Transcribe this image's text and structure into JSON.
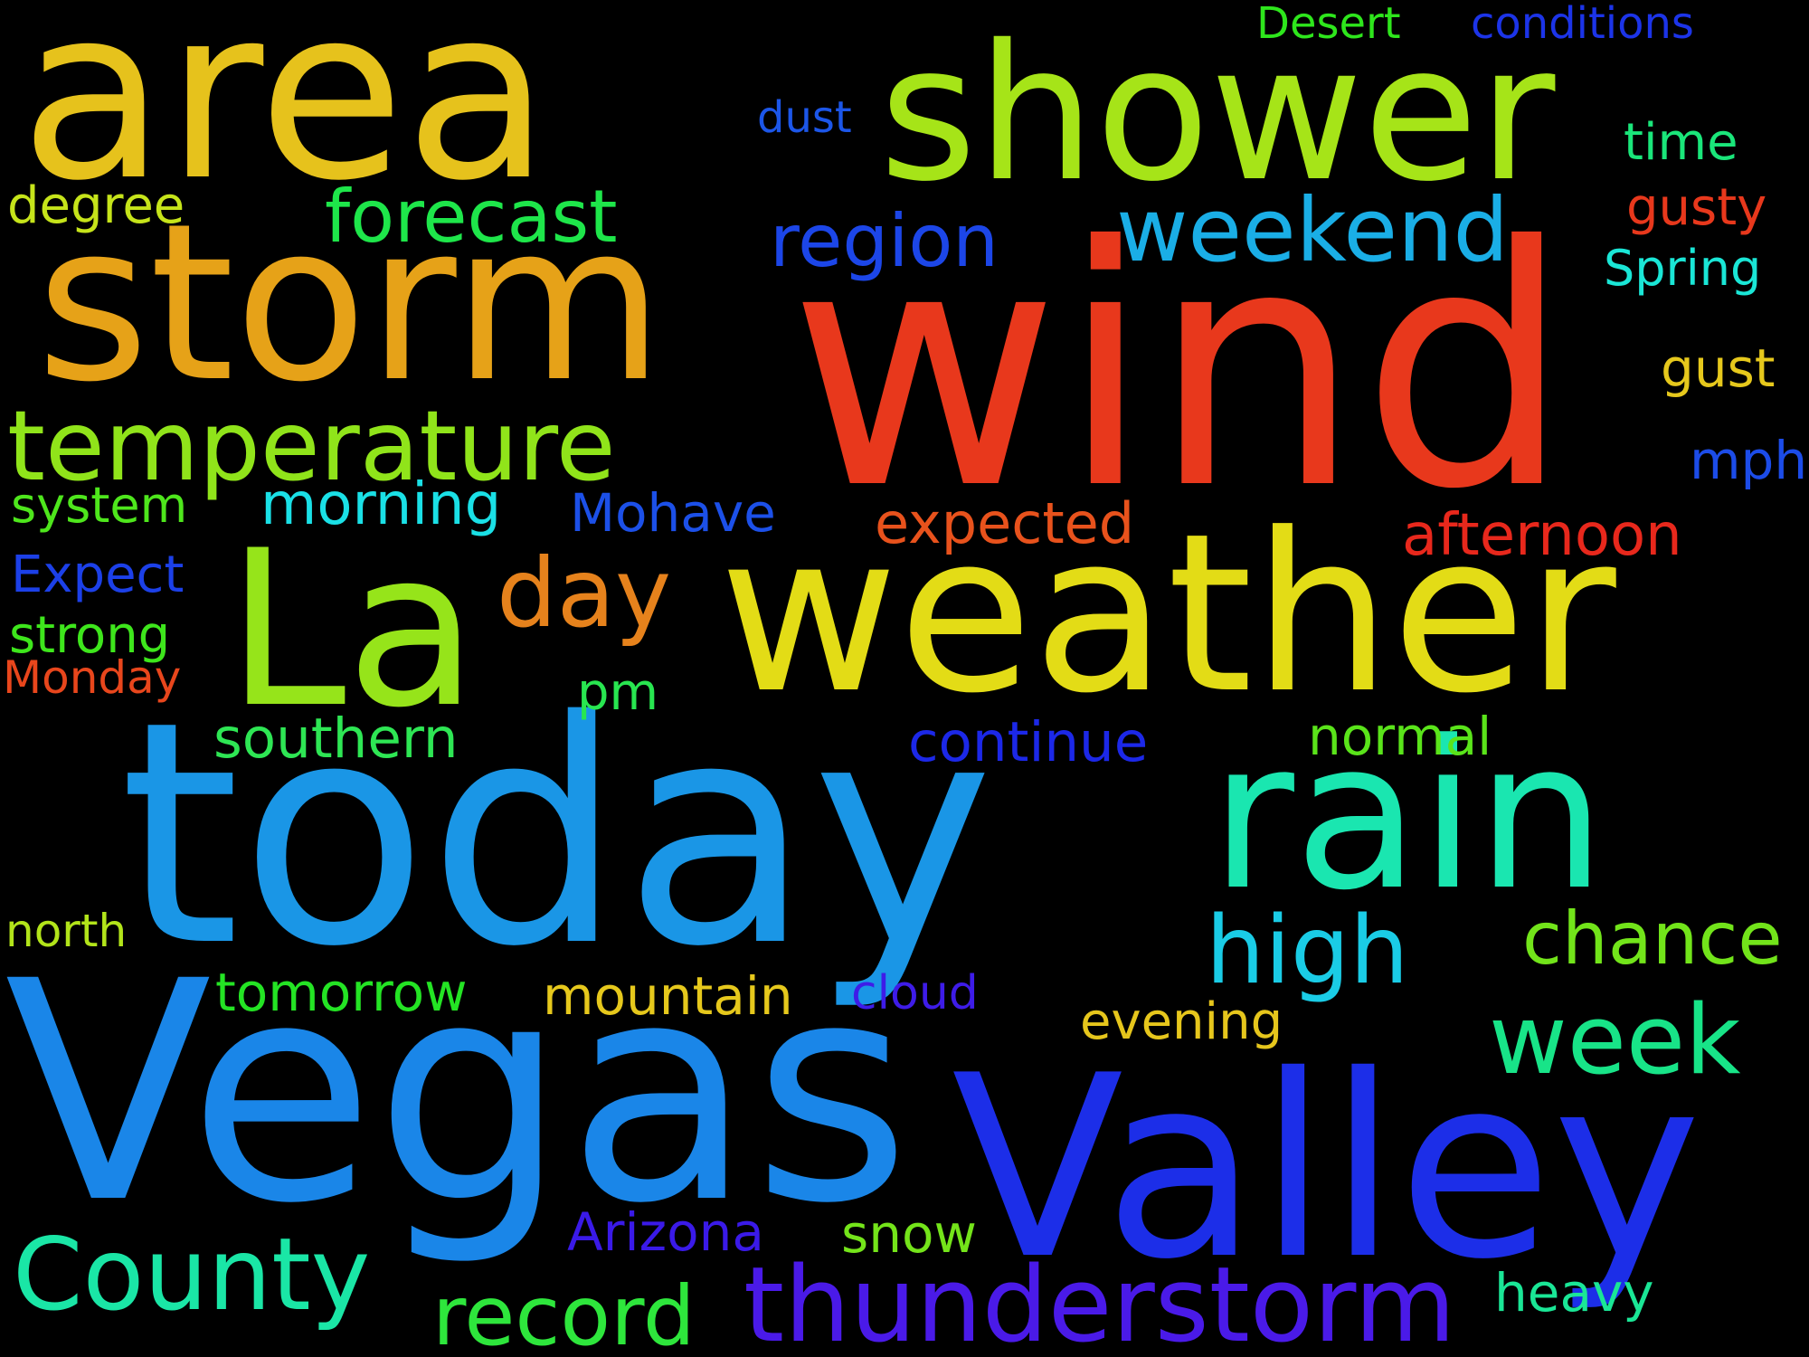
{
  "background": "#000000",
  "words": [
    {
      "text": "wind",
      "color": "#e8381c"
    },
    {
      "text": "today",
      "color": "#1a96e6"
    },
    {
      "text": "Vegas",
      "color": "#1a86e8"
    },
    {
      "text": "area",
      "color": "#e6c21c"
    },
    {
      "text": "weather",
      "color": "#e3dc16"
    },
    {
      "text": "storm",
      "color": "#e6a218"
    },
    {
      "text": "Valley",
      "color": "#1c2ee8"
    },
    {
      "text": "shower",
      "color": "#a6e418"
    },
    {
      "text": "rain",
      "color": "#1ae6b0"
    },
    {
      "text": "La",
      "color": "#96e41a"
    },
    {
      "text": "temperature",
      "color": "#90e41a"
    },
    {
      "text": "thunderstorm",
      "color": "#4a1ae8"
    },
    {
      "text": "County",
      "color": "#1ae6a6"
    },
    {
      "text": "week",
      "color": "#18e488"
    },
    {
      "text": "weekend",
      "color": "#1aaee6"
    },
    {
      "text": "high",
      "color": "#1acce6"
    },
    {
      "text": "day",
      "color": "#e6821c"
    },
    {
      "text": "record",
      "color": "#2ee63c"
    },
    {
      "text": "forecast",
      "color": "#1ee64a"
    },
    {
      "text": "chance",
      "color": "#72e41a"
    },
    {
      "text": "region",
      "color": "#1c46e8"
    },
    {
      "text": "morning",
      "color": "#1ae0e6"
    },
    {
      "text": "Mohave",
      "color": "#1c50e8"
    },
    {
      "text": "expected",
      "color": "#e8521c"
    },
    {
      "text": "afternoon",
      "color": "#e8281c"
    },
    {
      "text": "southern",
      "color": "#2ee654"
    },
    {
      "text": "continue",
      "color": "#1c28e8"
    },
    {
      "text": "normal",
      "color": "#5ae41a"
    },
    {
      "text": "mountain",
      "color": "#e6c81c"
    },
    {
      "text": "tomorrow",
      "color": "#24e424"
    },
    {
      "text": "evening",
      "color": "#e6c61c"
    },
    {
      "text": "Arizona",
      "color": "#3a1ae8"
    },
    {
      "text": "snow",
      "color": "#74e41a"
    },
    {
      "text": "heavy",
      "color": "#1ae696"
    },
    {
      "text": "cloud",
      "color": "#3e1ce8"
    },
    {
      "text": "system",
      "color": "#4ee61c"
    },
    {
      "text": "Expect",
      "color": "#1c40e8"
    },
    {
      "text": "strong",
      "color": "#3ee61c"
    },
    {
      "text": "Monday",
      "color": "#e8461c"
    },
    {
      "text": "degree",
      "color": "#c6e41a"
    },
    {
      "text": "north",
      "color": "#b2e41a"
    },
    {
      "text": "pm",
      "color": "#28e650"
    },
    {
      "text": "dust",
      "color": "#1c56e8"
    },
    {
      "text": "Desert",
      "color": "#2ee61c"
    },
    {
      "text": "conditions",
      "color": "#1c34e8"
    },
    {
      "text": "time",
      "color": "#1ae67a"
    },
    {
      "text": "gusty",
      "color": "#e8381c"
    },
    {
      "text": "Spring",
      "color": "#1ae6d6"
    },
    {
      "text": "gust",
      "color": "#e6c81c"
    },
    {
      "text": "mph",
      "color": "#1c4ce8"
    }
  ]
}
